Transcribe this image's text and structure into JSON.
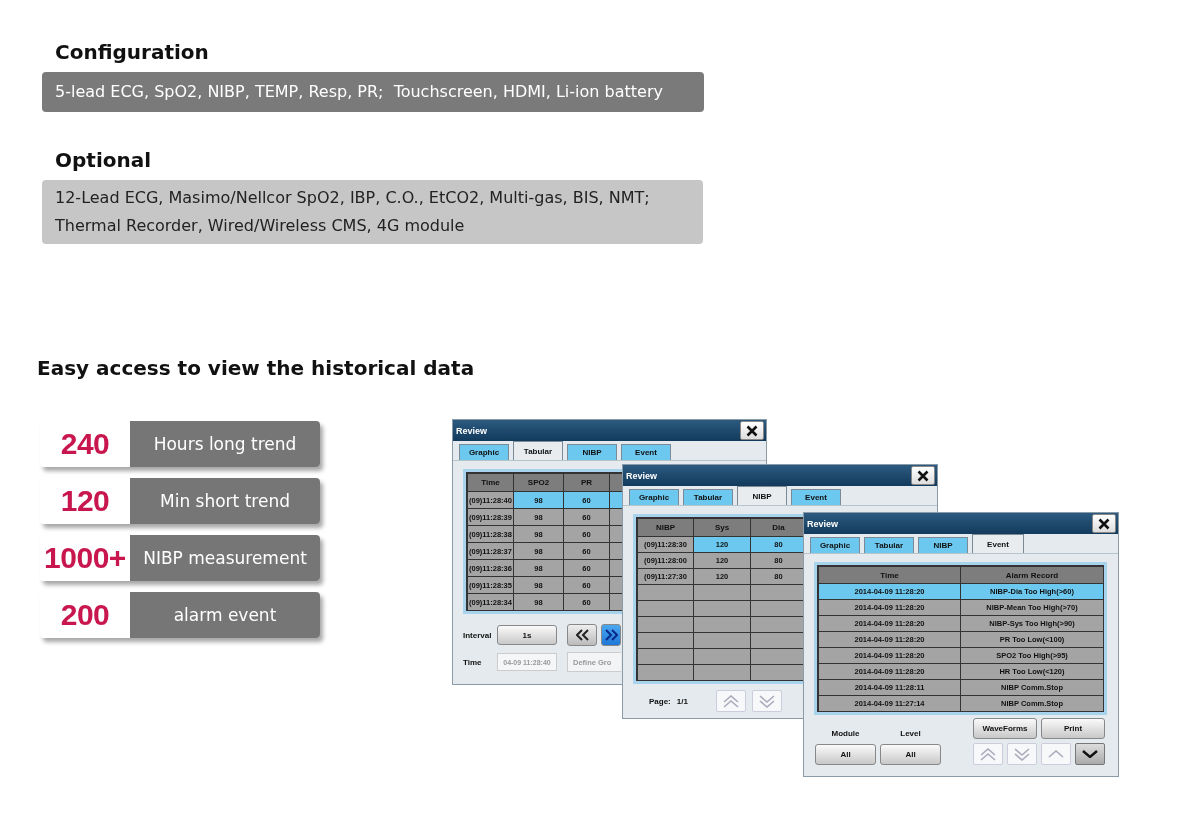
{
  "configuration": {
    "heading": "Configuration",
    "text": "5-lead ECG, SpO2, NIBP, TEMP, Resp, PR;  Touchscreen, HDMI, Li-ion battery"
  },
  "optional": {
    "heading": "Optional",
    "lines": [
      "12-Lead ECG, Masimo/Nellcor SpO2, IBP, C.O., EtCO2, Multi-gas, BIS, NMT;",
      "Thermal Recorder, Wired/Wireless CMS, 4G module"
    ]
  },
  "history": {
    "heading": "Easy access to view the historical data",
    "stats": [
      {
        "number": "240",
        "label": "Hours long trend"
      },
      {
        "number": "120",
        "label": "Min short trend"
      },
      {
        "number": "1000+",
        "label": "NIBP measurement"
      },
      {
        "number": "200",
        "label": "alarm event"
      }
    ]
  },
  "windows": [
    {
      "kind": "tabular",
      "title": "Review",
      "tabs": [
        {
          "label": "Graphic",
          "selected": false
        },
        {
          "label": "Tabular",
          "selected": true
        },
        {
          "label": "NIBP",
          "selected": false
        },
        {
          "label": "Event",
          "selected": false
        }
      ],
      "columns": [
        "Time",
        "SPO2",
        "PR"
      ],
      "rows": [
        {
          "cells": [
            "(09)11:28:40",
            "98",
            "60"
          ],
          "selected": true
        },
        {
          "cells": [
            "(09)11:28:39",
            "98",
            "60"
          ],
          "selected": false
        },
        {
          "cells": [
            "(09)11:28:38",
            "98",
            "60"
          ],
          "selected": false
        },
        {
          "cells": [
            "(09)11:28:37",
            "98",
            "60"
          ],
          "selected": false
        },
        {
          "cells": [
            "(09)11:28:36",
            "98",
            "60"
          ],
          "selected": false
        },
        {
          "cells": [
            "(09)11:28:35",
            "98",
            "60"
          ],
          "selected": false
        },
        {
          "cells": [
            "(09)11:28:34",
            "98",
            "60"
          ],
          "selected": false
        }
      ],
      "interval_label": "Interval",
      "interval_value": "1s",
      "time_label": "Time",
      "time_value": "04-09 11:28:40",
      "define_button": "Define Gro",
      "nav": [
        {
          "kind": "double-left",
          "selected": false
        },
        {
          "kind": "double-right",
          "selected": true
        }
      ]
    },
    {
      "kind": "nibp",
      "title": "Review",
      "tabs": [
        {
          "label": "Graphic",
          "selected": false
        },
        {
          "label": "Tabular",
          "selected": false
        },
        {
          "label": "NIBP",
          "selected": true
        },
        {
          "label": "Event",
          "selected": false
        }
      ],
      "columns": [
        "NIBP",
        "Sys",
        "Dia"
      ],
      "rows": [
        {
          "cells": [
            "(09)11:28:30",
            "120",
            "80"
          ],
          "selected": true
        },
        {
          "cells": [
            "(09)11:28:00",
            "120",
            "80"
          ],
          "selected": false
        },
        {
          "cells": [
            "(09)11:27:30",
            "120",
            "80"
          ],
          "selected": false
        }
      ],
      "page_label": "Page:",
      "page_value": "1/1",
      "nav": [
        {
          "kind": "double-up",
          "selected": false
        },
        {
          "kind": "double-down",
          "selected": false
        }
      ]
    },
    {
      "kind": "event",
      "title": "Review",
      "tabs": [
        {
          "label": "Graphic",
          "selected": false
        },
        {
          "label": "Tabular",
          "selected": false
        },
        {
          "label": "NIBP",
          "selected": false
        },
        {
          "label": "Event",
          "selected": true
        }
      ],
      "columns": [
        "Time",
        "Alarm Record"
      ],
      "rows": [
        {
          "cells": [
            "2014-04-09 11:28:20",
            "NIBP-Dia Too High(>60)"
          ],
          "selected": true
        },
        {
          "cells": [
            "2014-04-09 11:28:20",
            "NIBP-Mean Too High(>70)"
          ],
          "selected": false
        },
        {
          "cells": [
            "2014-04-09 11:28:20",
            "NIBP-Sys Too High(>90)"
          ],
          "selected": false
        },
        {
          "cells": [
            "2014-04-09 11:28:20",
            "PR Too Low(<100)"
          ],
          "selected": false
        },
        {
          "cells": [
            "2014-04-09 11:28:20",
            "SPO2 Too High(>95)"
          ],
          "selected": false
        },
        {
          "cells": [
            "2014-04-09 11:28:20",
            "HR Too Low(<120)"
          ],
          "selected": false
        },
        {
          "cells": [
            "2014-04-09 11:28:11",
            "NIBP Comm.Stop"
          ],
          "selected": false
        },
        {
          "cells": [
            "2014-04-09 11:27:14",
            "NIBP Comm.Stop"
          ],
          "selected": false
        }
      ],
      "module_label": "Module",
      "level_label": "Level",
      "module_value": "All",
      "level_value": "All",
      "buttons": [
        "WaveForms",
        "Print"
      ],
      "nav": [
        {
          "kind": "double-up",
          "selected": false
        },
        {
          "kind": "double-down",
          "selected": false
        },
        {
          "kind": "up",
          "selected": false
        },
        {
          "kind": "down",
          "selected": true
        }
      ]
    }
  ]
}
